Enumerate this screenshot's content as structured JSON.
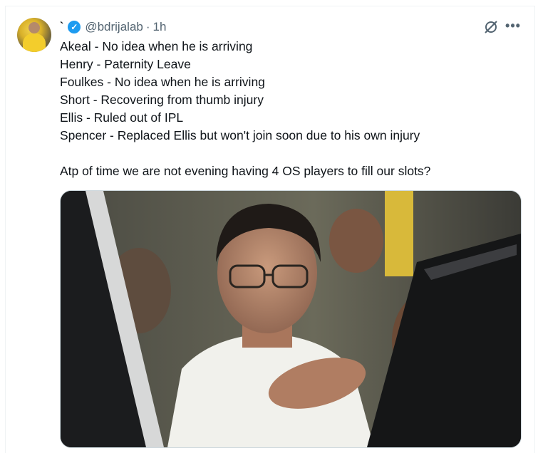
{
  "post": {
    "display_name": "`",
    "handle": "@bdrijalab",
    "separator": "·",
    "time": "1h",
    "lines": [
      "Akeal - No idea when he is arriving",
      "Henry - Paternity Leave",
      "Foulkes - No idea when he is arriving",
      "Short - Recovering from thumb injury",
      "Ellis - Ruled out of IPL",
      "Spencer - Replaced Ellis but won't join soon due to his own injury"
    ],
    "question": "Atp of time we are not evening having 4 OS players to fill our slots?"
  },
  "icons": {
    "verified": "verified-badge-icon",
    "grok": "grok-icon",
    "more": "more-options-icon"
  },
  "colors": {
    "verified_blue": "#1d9bf0",
    "secondary_text": "#536471",
    "border": "#cfd9de"
  }
}
